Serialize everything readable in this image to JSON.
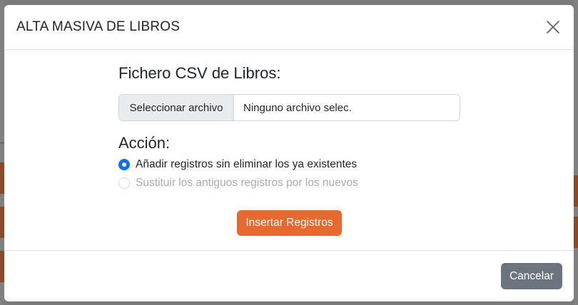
{
  "modal": {
    "title": "ALTA MASIVA DE LIBROS",
    "close_icon": "close-icon"
  },
  "form": {
    "file_label": "Fichero CSV de Libros:",
    "file_button": "Seleccionar archivo",
    "file_value": "Ninguno archivo selec.",
    "action_label": "Acción:",
    "options": [
      {
        "label": "Añadir registros sin eliminar los ya existentes",
        "checked": true,
        "disabled": false
      },
      {
        "label": "Sustituir los antiguos registros por los nuevos",
        "checked": false,
        "disabled": true
      }
    ],
    "submit_label": "Insertar Registros"
  },
  "footer": {
    "cancel_label": "Cancelar"
  },
  "colors": {
    "accent": "#e8692e",
    "primary": "#0d6efd",
    "secondary": "#6c757d"
  }
}
